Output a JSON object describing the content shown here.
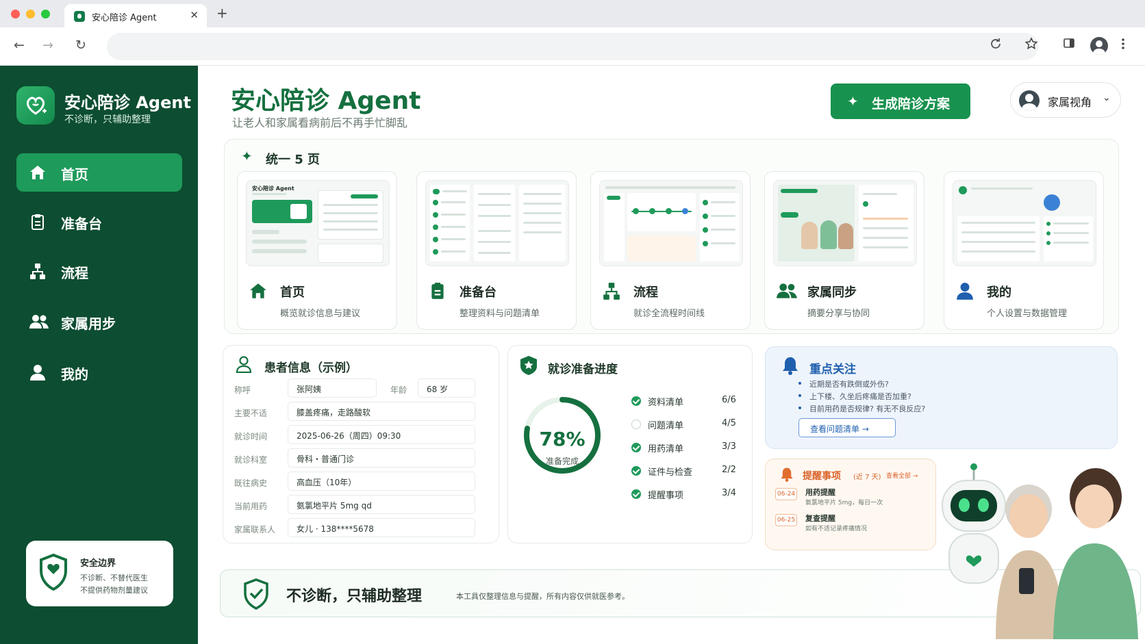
{
  "browser": {
    "tab_title": "安心陪诊 Agent",
    "tab_close": "✕",
    "new_tab": "+",
    "back": "←",
    "forward": "→",
    "reload": "↻"
  },
  "sidebar": {
    "brand_title": "安心陪诊 Agent",
    "brand_sub": "不诊断，只辅助整理",
    "items": [
      {
        "label": "首页",
        "icon": "home-icon",
        "active": true
      },
      {
        "label": "准备台",
        "icon": "clipboard-icon",
        "active": false
      },
      {
        "label": "流程",
        "icon": "flow-icon",
        "active": false
      },
      {
        "label": "家属用步",
        "icon": "family-icon",
        "active": false
      },
      {
        "label": "我的",
        "icon": "user-icon",
        "active": false
      }
    ],
    "safe": {
      "title": "安全边界",
      "lines": [
        "不诊断、不替代医生",
        "不提供药物剂量建议"
      ]
    }
  },
  "header": {
    "title": "安心陪诊 Agent",
    "subtitle": "让老人和家属看病前后不再手忙脚乱",
    "generate_label": "生成陪诊方案",
    "role_label": "家属视角"
  },
  "pages": {
    "heading": "统一 5 页",
    "thumb_brand": "安心陪诊 Agent",
    "cards": [
      {
        "title": "首页",
        "desc": "概览就诊信息与建议",
        "icon": "home-icon"
      },
      {
        "title": "准备台",
        "desc": "整理资料与问题清单",
        "icon": "clipboard-icon"
      },
      {
        "title": "流程",
        "desc": "就诊全流程时间线",
        "icon": "flow-icon"
      },
      {
        "title": "家属同步",
        "desc": "摘要分享与协同",
        "icon": "family-icon"
      },
      {
        "title": "我的",
        "desc": "个人设置与数据管理",
        "icon": "user-icon"
      }
    ]
  },
  "patient": {
    "title": "患者信息（示例）",
    "name_label": "称呼",
    "name": "张阿姨",
    "age_label": "年龄",
    "age": "68 岁",
    "rows": [
      {
        "label": "主要不适",
        "value": "膝盖疼痛，走路酸软"
      },
      {
        "label": "就诊时间",
        "value": "2025-06-26（周四）09:30"
      },
      {
        "label": "就诊科室",
        "value": "骨科・普通门诊"
      },
      {
        "label": "既往病史",
        "value": "高血压（10年）"
      },
      {
        "label": "当前用药",
        "value": "氨氯地平片 5mg qd"
      },
      {
        "label": "家属联系人",
        "value": "女儿 · 138****5678"
      }
    ]
  },
  "progress": {
    "title": "就诊准备进度",
    "percent_text": "78%",
    "percent": 78,
    "label": "准备完成",
    "items": [
      {
        "label": "资料清单",
        "count": "6/6",
        "done": true
      },
      {
        "label": "问题清单",
        "count": "4/5",
        "done": false
      },
      {
        "label": "用药清单",
        "count": "3/3",
        "done": true
      },
      {
        "label": "证件与检查",
        "count": "2/2",
        "done": true
      },
      {
        "label": "提醒事项",
        "count": "3/4",
        "done": true
      }
    ]
  },
  "focus": {
    "title": "重点关注",
    "items": [
      "近期是否有跌倒或外伤?",
      "上下楼、久坐后疼痛是否加重?",
      "目前用药是否规律? 有无不良反应?"
    ],
    "button": "查看问题清单 →"
  },
  "reminders": {
    "title": "提醒事项",
    "sub": "(近 7 天)",
    "view_all": "查看全部 →",
    "items": [
      {
        "date": "06-24",
        "title": "用药提醒",
        "desc": "氨氯地平片 5mg，每日一次"
      },
      {
        "date": "06-25",
        "title": "复查提醒",
        "desc": "如有不适记录疼痛情况"
      }
    ]
  },
  "banner": {
    "main": "不诊断，只辅助整理",
    "note": "本工具仅整理信息与提醒，所有内容仅供就医参考。"
  },
  "colors": {
    "sidebar": "#0d4d31",
    "accent": "#1e9a5a",
    "title_green": "#15703f",
    "focus_blue": "#1f5fae",
    "reminder_orange": "#d9642b"
  }
}
